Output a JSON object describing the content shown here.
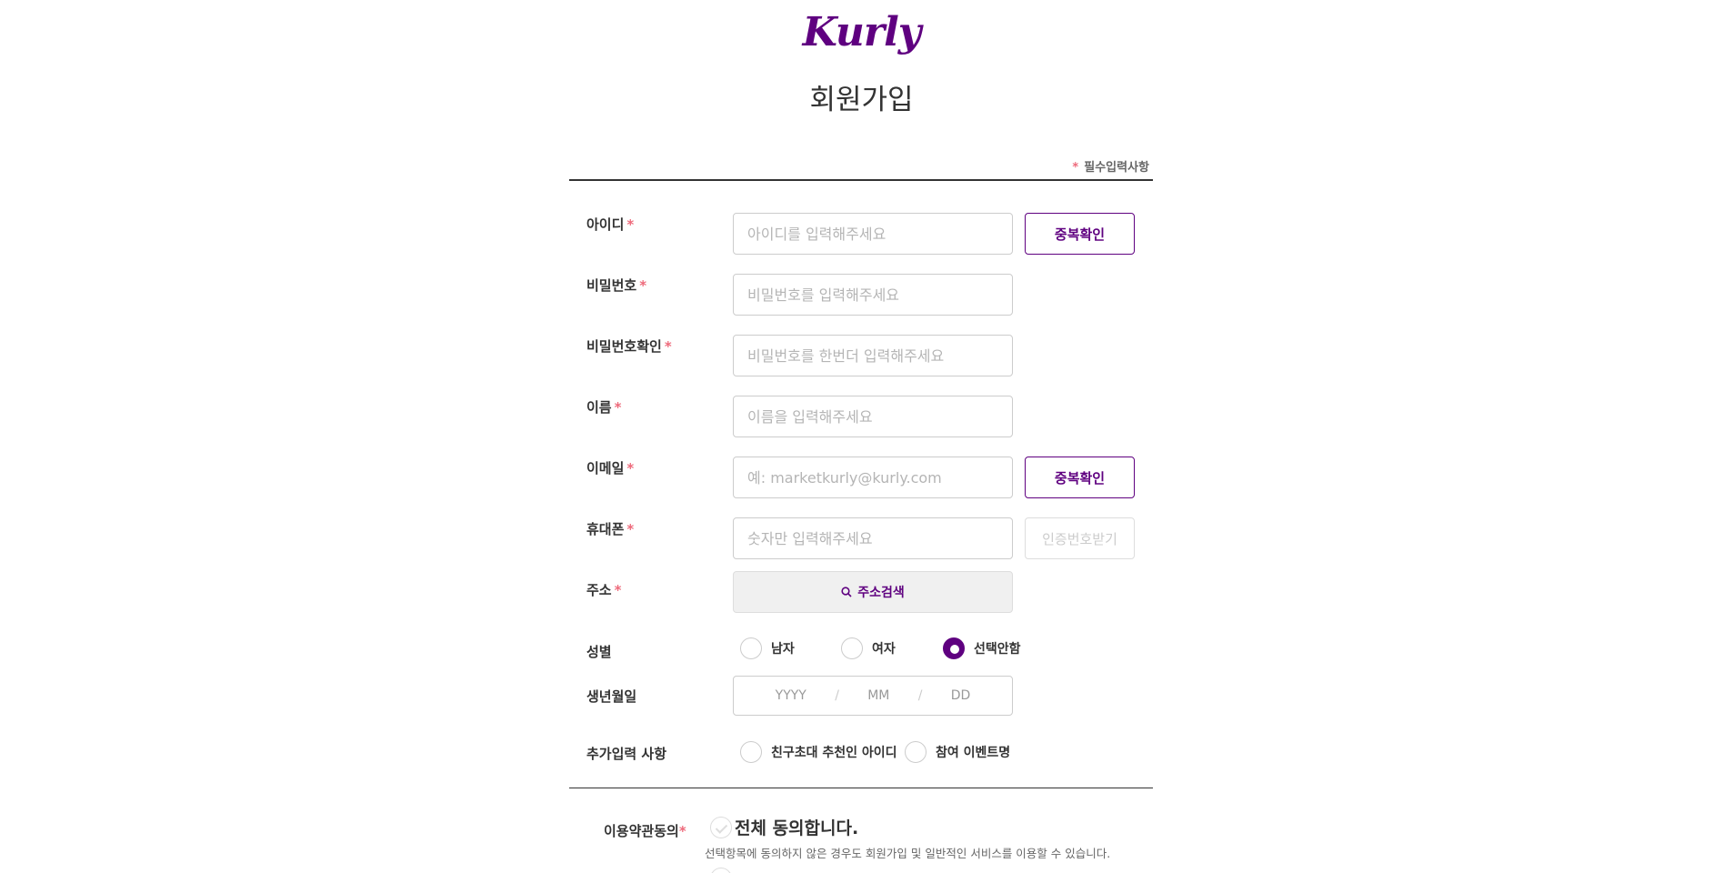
{
  "brand": {
    "logo_text": "Kurly",
    "accent_color": "#5f0080",
    "required_color": "#ee6a7b"
  },
  "page": {
    "title": "회원가입",
    "required_note": "필수입력사항",
    "required_star": "*"
  },
  "form": {
    "id": {
      "label": "아이디",
      "placeholder": "아이디를 입력해주세요",
      "button": "중복확인"
    },
    "password": {
      "label": "비밀번호",
      "placeholder": "비밀번호를 입력해주세요"
    },
    "password_confirm": {
      "label": "비밀번호확인",
      "placeholder": "비밀번호를 한번더 입력해주세요"
    },
    "name": {
      "label": "이름",
      "placeholder": "이름을 입력해주세요"
    },
    "email": {
      "label": "이메일",
      "placeholder": "예: marketkurly@kurly.com",
      "button": "중복확인"
    },
    "phone": {
      "label": "휴대폰",
      "placeholder": "숫자만 입력해주세요",
      "button": "인증번호받기"
    },
    "address": {
      "label": "주소",
      "button": "주소검색",
      "icon": "search-icon"
    },
    "gender": {
      "label": "성별",
      "options": [
        "남자",
        "여자",
        "선택안함"
      ],
      "selected": "선택안함"
    },
    "birth": {
      "label": "생년월일",
      "year_placeholder": "YYYY",
      "month_placeholder": "MM",
      "day_placeholder": "DD",
      "separator": "/"
    },
    "extra": {
      "label": "추가입력 사항",
      "options": [
        "친구초대 추천인 아이디",
        "참여 이벤트명"
      ]
    }
  },
  "terms": {
    "label": "이용약관동의",
    "agree_all": "전체 동의합니다.",
    "description": "선택항목에 동의하지 않은 경우도 회원가입 및 일반적인 서비스를 이용할 수 있습니다."
  }
}
